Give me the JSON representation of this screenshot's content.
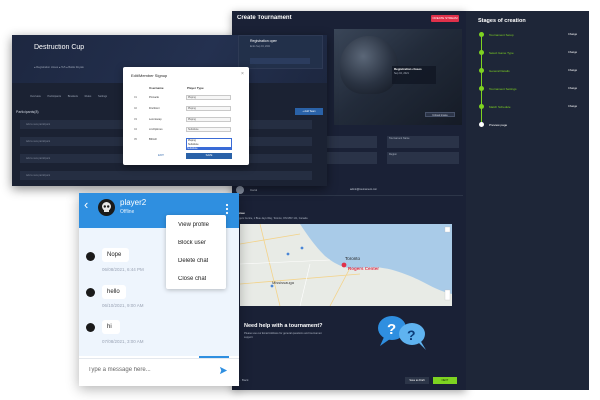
{
  "main": {
    "title": "Create Tournament",
    "create_button": "CREATE STREAM",
    "hero_card_title": "Registration closes",
    "hero_card_sub": "Sep 04, 2021",
    "hero_card_button": "Upload image",
    "venue_label": "Venue",
    "venue_address": "Rogers Centre, 1 Blue Jays Way, Toronto, ON M5V 1J1, Canada",
    "map_toronto": "Toronto",
    "map_rogers": "Rogers Center",
    "map_mississauga": "Mississauga",
    "help_title": "Need help with a tournament?",
    "help_text": "Please use our Email Address for general questions and tournament",
    "help_text2": "support",
    "back": "← Back",
    "save_draft": "Save as Draft",
    "next": "NEXT",
    "organizer_name": "Carol",
    "organizer_email": "admin@tournament.com",
    "strip_labels": [
      "",
      "",
      "Tournament Name",
      "Region"
    ]
  },
  "stages": {
    "title": "Stages of creation",
    "items": [
      {
        "label": "Tournament Setup",
        "change": "Change",
        "done": true
      },
      {
        "label": "Select Game Type",
        "change": "Change",
        "done": true
      },
      {
        "label": "General Details",
        "change": "Change",
        "done": true
      },
      {
        "label": "Tournament Settings",
        "change": "Change",
        "done": true
      },
      {
        "label": "Match Schedule",
        "change": "Change",
        "done": true
      },
      {
        "label": "Preview page",
        "change": "",
        "done": false
      }
    ]
  },
  "left": {
    "title": "Destruction Cup",
    "meta": "● Registration closes     ● 5v5     ● Battle Royale",
    "card_title": "Registration open",
    "card_sub": "Ends Sep 04, 2021",
    "tabs": "Overview  Participants  Brackets  Rules  Settings",
    "participants_label": "Participants(8)",
    "add_button": "+ Add Team",
    "row_text": "Add a new participant"
  },
  "modal": {
    "title": "Edit/Member Signup",
    "close": "×",
    "col_username": "Username",
    "col_type": "Player Type",
    "rows": [
      {
        "num": "01",
        "name": "Pinnacle",
        "type": "Playing"
      },
      {
        "num": "02",
        "name": "FireStorm",
        "type": "Playing"
      },
      {
        "num": "03",
        "name": "Lemniscap",
        "type": "Playing"
      },
      {
        "num": "04",
        "name": "xxxOptimus",
        "type": "Substitute"
      },
      {
        "num": "05",
        "name": "BR-kill",
        "type": "Playing"
      }
    ],
    "dropdown_options": [
      "Playing",
      "Substitute",
      "Substitute"
    ],
    "exit": "EXIT",
    "save": "SAVE"
  },
  "chat": {
    "user": "player2",
    "status": "Offline",
    "menu": [
      "View profile",
      "Block user",
      "Delete chat",
      "Close chat"
    ],
    "messages": [
      {
        "text": "Nope",
        "time": "06/08/2021, 6:44 PM"
      },
      {
        "text": "hello",
        "time": "06/10/2021, 9:00 AM"
      },
      {
        "text": "hi",
        "time": "07/08/2021, 3:00 AM"
      }
    ],
    "input_placeholder": "Type a message here..."
  },
  "colors": {
    "accent_green": "#7ed321",
    "chat_blue": "#2f8fe0",
    "panel_dark": "#1a2136",
    "danger_red": "#e0304a"
  }
}
